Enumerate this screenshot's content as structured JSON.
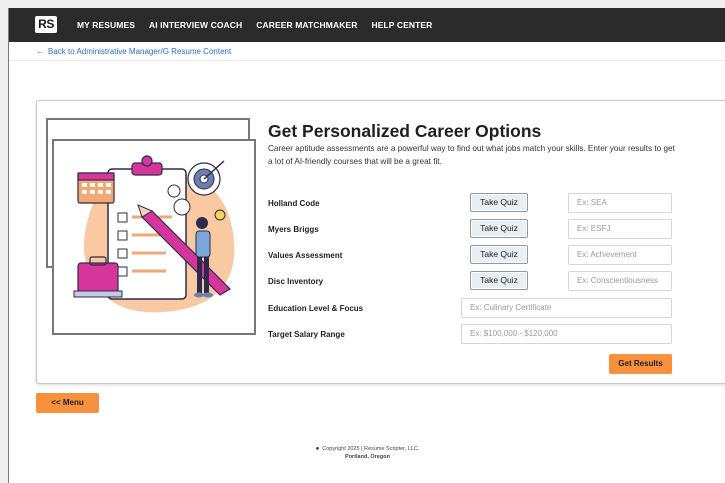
{
  "app": {
    "logo_text": "RS"
  },
  "nav": {
    "items": [
      {
        "label": "MY RESUMES"
      },
      {
        "label": "AI INTERVIEW COACH"
      },
      {
        "label": "CAREER MATCHMAKER"
      },
      {
        "label": "HELP CENTER"
      }
    ]
  },
  "back_link": {
    "arrow": "←",
    "label": "Back to Administrative Manager/G Resume Content"
  },
  "card": {
    "title": "Get Personalized Career Options",
    "description": "Career aptitude assessments are a powerful way to find out what jobs match your skills. Enter your results to get a lot of AI-friendly courses that will be a great fit.",
    "rows": [
      {
        "label": "Holland Code",
        "button": "Take Quiz",
        "placeholder": "Ex: SEA"
      },
      {
        "label": "Myers Briggs",
        "button": "Take Quiz",
        "placeholder": "Ex: ESFJ"
      },
      {
        "label": "Values Assessment",
        "button": "Take Quiz",
        "placeholder": "Ex: Achievement"
      },
      {
        "label": "Disc Inventory",
        "button": "Take Quiz",
        "placeholder": "Ex:  Conscientiousness"
      },
      {
        "label": "Education Level & Focus",
        "placeholder": "Ex: Culinary Certificate"
      },
      {
        "label": "Target Salary Range",
        "placeholder": "Ex: $100,000 - $120,000"
      }
    ],
    "submit_label": "Get Results"
  },
  "menu_button": {
    "label": "<< Menu"
  },
  "footer": {
    "icon": "copyright-icon",
    "copyright": "Copyright 2025 | Resume Scripter, LLC.",
    "location": "Portland, Oregon"
  },
  "colors": {
    "topbar": "#2b2b2b",
    "accent": "#f7913d",
    "link": "#2d6fbf"
  }
}
